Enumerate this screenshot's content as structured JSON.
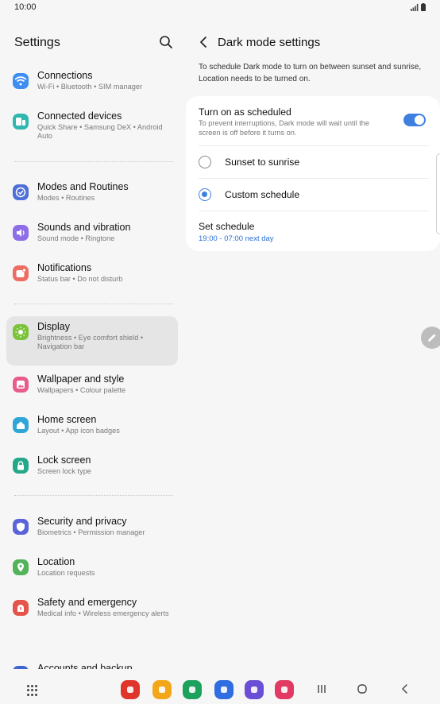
{
  "status_bar": {
    "time": "10:00"
  },
  "settings": {
    "title": "Settings",
    "items": [
      {
        "id": "connections",
        "label": "Connections",
        "sub": "Wi-Fi  •  Bluetooth  •  SIM manager",
        "icon": "wifi-icon",
        "color": "#3d8ef0"
      },
      {
        "id": "connected-devices",
        "label": "Connected devices",
        "sub": "Quick Share  •  Samsung DeX  •  Android Auto",
        "icon": "connected-devices-icon",
        "color": "#2fb7b0"
      },
      {
        "id": "modes-routines",
        "label": "Modes and Routines",
        "sub": "Modes  •  Routines",
        "icon": "check-circle-icon",
        "color": "#4f6fd8"
      },
      {
        "id": "sounds-vibration",
        "label": "Sounds and vibration",
        "sub": "Sound mode  •  Ringtone",
        "icon": "volume-icon",
        "color": "#8d6ee6"
      },
      {
        "id": "notifications",
        "label": "Notifications",
        "sub": "Status bar  •  Do not disturb",
        "icon": "notification-icon",
        "color": "#ee6d62"
      },
      {
        "id": "display",
        "label": "Display",
        "sub": "Brightness  •  Eye comfort shield  •  Navigation bar",
        "icon": "sun-icon",
        "color": "#7bc33a"
      },
      {
        "id": "wallpaper-style",
        "label": "Wallpaper and style",
        "sub": "Wallpapers  •  Colour palette",
        "icon": "wallpaper-icon",
        "color": "#e85c8d"
      },
      {
        "id": "home-screen",
        "label": "Home screen",
        "sub": "Layout  •  App icon badges",
        "icon": "home-icon",
        "color": "#2ea7d8"
      },
      {
        "id": "lock-screen",
        "label": "Lock screen",
        "sub": "Screen lock type",
        "icon": "lock-icon",
        "color": "#23a889"
      },
      {
        "id": "security-privacy",
        "label": "Security and privacy",
        "sub": "Biometrics  •  Permission manager",
        "icon": "shield-icon",
        "color": "#5b63d8"
      },
      {
        "id": "location",
        "label": "Location",
        "sub": "Location requests",
        "icon": "location-pin-icon",
        "color": "#53b35a"
      },
      {
        "id": "safety-emergency",
        "label": "Safety and emergency",
        "sub": "Medical info  •  Wireless emergency alerts",
        "icon": "emergency-icon",
        "color": "#e5544b"
      },
      {
        "id": "accounts-backup",
        "label": "Accounts and backup",
        "sub": "",
        "icon": "accounts-icon",
        "color": "#3f66cf"
      }
    ]
  },
  "dark_mode": {
    "title": "Dark mode settings",
    "info": "To schedule Dark mode to turn on between sunset and sunrise, Location needs to be turned on.",
    "turn_on_scheduled": {
      "label": "Turn on as scheduled",
      "sub": "To prevent interruptions, Dark mode will wait until the screen is off before it turns on.",
      "enabled": true
    },
    "options": [
      {
        "label": "Sunset to sunrise",
        "selected": false
      },
      {
        "label": "Custom schedule",
        "selected": true
      }
    ],
    "set_schedule": {
      "label": "Set schedule",
      "value": "19:00 - 07:00 next day"
    }
  },
  "accent_color": "#3e7fe0",
  "dock_apps": [
    {
      "name": "flipboard-app-icon",
      "color": "#e0352b"
    },
    {
      "name": "my-files-app-icon",
      "color": "#f2a71b"
    },
    {
      "name": "phone-app-icon",
      "color": "#1ca25c"
    },
    {
      "name": "messages-app-icon",
      "color": "#2f6de1"
    },
    {
      "name": "internet-app-icon",
      "color": "#6a4fd6"
    },
    {
      "name": "camera-app-icon",
      "color": "#e23a63"
    }
  ]
}
